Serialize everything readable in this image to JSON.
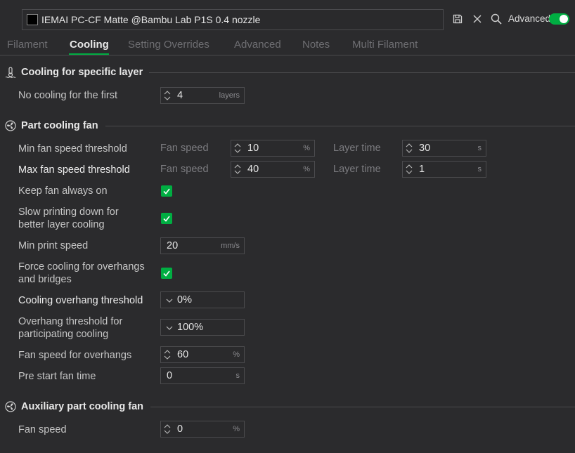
{
  "header": {
    "preset_name": "IEMAI PC-CF Matte @Bambu Lab P1S 0.4 nozzle",
    "advanced_label": "Advanced",
    "swatch_color": "#000000",
    "accent_color": "#00ae42",
    "icons": [
      "save-icon",
      "close-icon",
      "search-icon"
    ]
  },
  "tabs": [
    "Filament",
    "Cooling",
    "Setting Overrides",
    "Advanced",
    "Notes",
    "Multi Filament"
  ],
  "active_tab": "Cooling",
  "sections": {
    "specific_layer": {
      "title": "Cooling for specific layer",
      "no_cooling": {
        "label": "No cooling for the first",
        "value": "4",
        "unit": "layers"
      }
    },
    "part_fan": {
      "title": "Part cooling fan",
      "min_fan": {
        "label": "Min fan speed threshold",
        "fan_label": "Fan speed",
        "fan_value": "10",
        "fan_unit": "%",
        "time_label": "Layer time",
        "time_value": "30",
        "time_unit": "s"
      },
      "max_fan": {
        "label": "Max fan speed threshold",
        "fan_label": "Fan speed",
        "fan_value": "40",
        "fan_unit": "%",
        "time_label": "Layer time",
        "time_value": "1",
        "time_unit": "s"
      },
      "keep_fan": {
        "label": "Keep fan always on",
        "checked": true
      },
      "slow_down": {
        "label_1": "Slow printing down for",
        "label_2": "better layer cooling",
        "checked": true
      },
      "min_speed": {
        "label": "Min print speed",
        "value": "20",
        "unit": "mm/s"
      },
      "force_cooling": {
        "label_1": "Force cooling for overhangs",
        "label_2": "and bridges",
        "checked": true
      },
      "overhang_threshold": {
        "label": "Cooling overhang threshold",
        "value": "0%"
      },
      "overhang_participating": {
        "label_1": "Overhang threshold for",
        "label_2": "participating cooling",
        "value": "100%"
      },
      "fan_overhangs": {
        "label": "Fan speed for overhangs",
        "value": "60",
        "unit": "%"
      },
      "pre_start": {
        "label": "Pre start fan time",
        "value": "0",
        "unit": "s"
      }
    },
    "aux_fan": {
      "title": "Auxiliary part cooling fan",
      "fan_speed": {
        "label": "Fan speed",
        "value": "0",
        "unit": "%"
      }
    }
  }
}
